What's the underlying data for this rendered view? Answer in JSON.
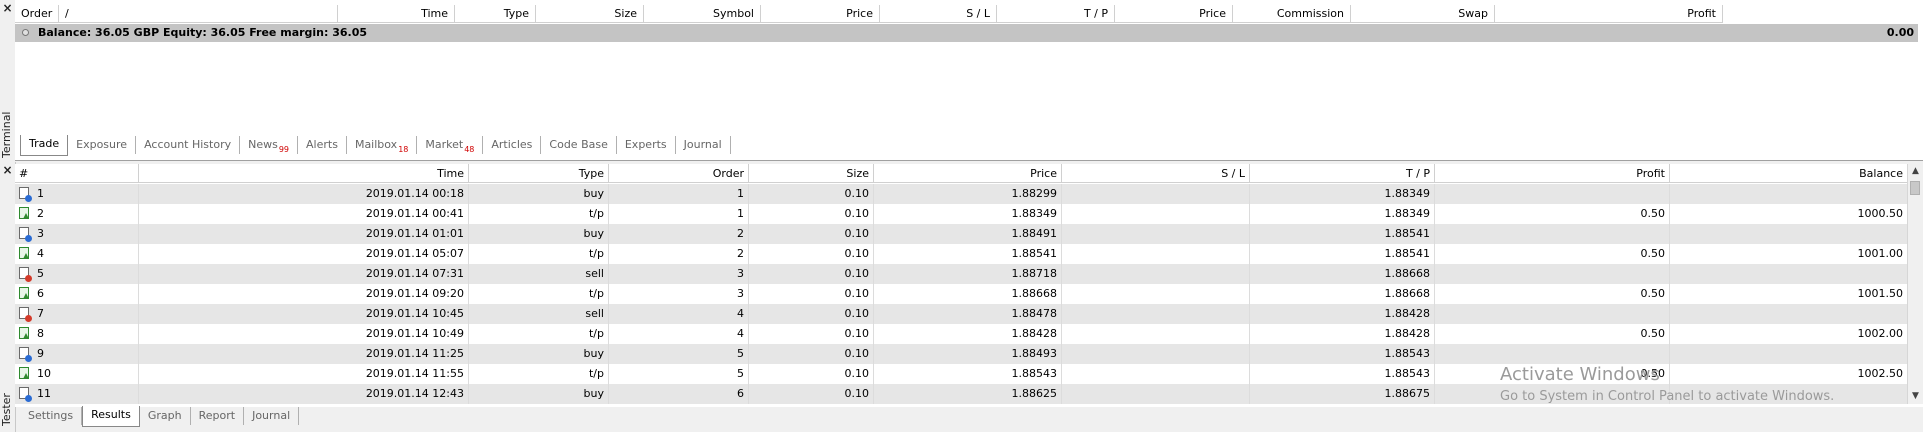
{
  "terminal": {
    "side_label": "Terminal",
    "close_glyph": "×",
    "columns": [
      "Order",
      "/",
      "Time",
      "Type",
      "Size",
      "Symbol",
      "Price",
      "S / L",
      "T / P",
      "Price",
      "Commission",
      "Swap",
      "Profit"
    ],
    "balance_text": "Balance: 36.05 GBP  Equity: 36.05  Free margin: 36.05",
    "balance_profit": "0.00",
    "tabs": [
      {
        "label": "Trade",
        "badge": ""
      },
      {
        "label": "Exposure",
        "badge": ""
      },
      {
        "label": "Account History",
        "badge": ""
      },
      {
        "label": "News",
        "badge": "99"
      },
      {
        "label": "Alerts",
        "badge": ""
      },
      {
        "label": "Mailbox",
        "badge": "18"
      },
      {
        "label": "Market",
        "badge": "48"
      },
      {
        "label": "Articles",
        "badge": ""
      },
      {
        "label": "Code Base",
        "badge": ""
      },
      {
        "label": "Experts",
        "badge": ""
      },
      {
        "label": "Journal",
        "badge": ""
      }
    ],
    "active_tab": "Trade"
  },
  "tester": {
    "side_label": "Tester",
    "close_glyph": "×",
    "columns": [
      "#",
      "Time",
      "Type",
      "Order",
      "Size",
      "Price",
      "S / L",
      "T / P",
      "Profit",
      "Balance"
    ],
    "rows": [
      {
        "num": "1",
        "time": "2019.01.14 00:18",
        "type": "buy",
        "icon": "buy",
        "order": "1",
        "size": "0.10",
        "price": "1.88299",
        "sl": "",
        "tp": "1.88349",
        "profit": "",
        "balance": ""
      },
      {
        "num": "2",
        "time": "2019.01.14 00:41",
        "type": "t/p",
        "icon": "tp",
        "order": "1",
        "size": "0.10",
        "price": "1.88349",
        "sl": "",
        "tp": "1.88349",
        "profit": "0.50",
        "balance": "1000.50"
      },
      {
        "num": "3",
        "time": "2019.01.14 01:01",
        "type": "buy",
        "icon": "buy",
        "order": "2",
        "size": "0.10",
        "price": "1.88491",
        "sl": "",
        "tp": "1.88541",
        "profit": "",
        "balance": ""
      },
      {
        "num": "4",
        "time": "2019.01.14 05:07",
        "type": "t/p",
        "icon": "tp",
        "order": "2",
        "size": "0.10",
        "price": "1.88541",
        "sl": "",
        "tp": "1.88541",
        "profit": "0.50",
        "balance": "1001.00"
      },
      {
        "num": "5",
        "time": "2019.01.14 07:31",
        "type": "sell",
        "icon": "sell",
        "order": "3",
        "size": "0.10",
        "price": "1.88718",
        "sl": "",
        "tp": "1.88668",
        "profit": "",
        "balance": ""
      },
      {
        "num": "6",
        "time": "2019.01.14 09:20",
        "type": "t/p",
        "icon": "tp",
        "order": "3",
        "size": "0.10",
        "price": "1.88668",
        "sl": "",
        "tp": "1.88668",
        "profit": "0.50",
        "balance": "1001.50"
      },
      {
        "num": "7",
        "time": "2019.01.14 10:45",
        "type": "sell",
        "icon": "sell",
        "order": "4",
        "size": "0.10",
        "price": "1.88478",
        "sl": "",
        "tp": "1.88428",
        "profit": "",
        "balance": ""
      },
      {
        "num": "8",
        "time": "2019.01.14 10:49",
        "type": "t/p",
        "icon": "tp",
        "order": "4",
        "size": "0.10",
        "price": "1.88428",
        "sl": "",
        "tp": "1.88428",
        "profit": "0.50",
        "balance": "1002.00"
      },
      {
        "num": "9",
        "time": "2019.01.14 11:25",
        "type": "buy",
        "icon": "buy",
        "order": "5",
        "size": "0.10",
        "price": "1.88493",
        "sl": "",
        "tp": "1.88543",
        "profit": "",
        "balance": ""
      },
      {
        "num": "10",
        "time": "2019.01.14 11:55",
        "type": "t/p",
        "icon": "tp",
        "order": "5",
        "size": "0.10",
        "price": "1.88543",
        "sl": "",
        "tp": "1.88543",
        "profit": "0.50",
        "balance": "1002.50"
      },
      {
        "num": "11",
        "time": "2019.01.14 12:43",
        "type": "buy",
        "icon": "buy",
        "order": "6",
        "size": "0.10",
        "price": "1.88625",
        "sl": "",
        "tp": "1.88675",
        "profit": "",
        "balance": ""
      }
    ],
    "tabs": [
      {
        "label": "Settings"
      },
      {
        "label": "Results"
      },
      {
        "label": "Graph"
      },
      {
        "label": "Report"
      },
      {
        "label": "Journal"
      }
    ],
    "active_tab": "Results",
    "scroll_up": "▲",
    "scroll_down": "▼"
  },
  "watermark": {
    "title": "Activate Windows",
    "subtitle": "Go to System in Control Panel to activate Windows."
  }
}
